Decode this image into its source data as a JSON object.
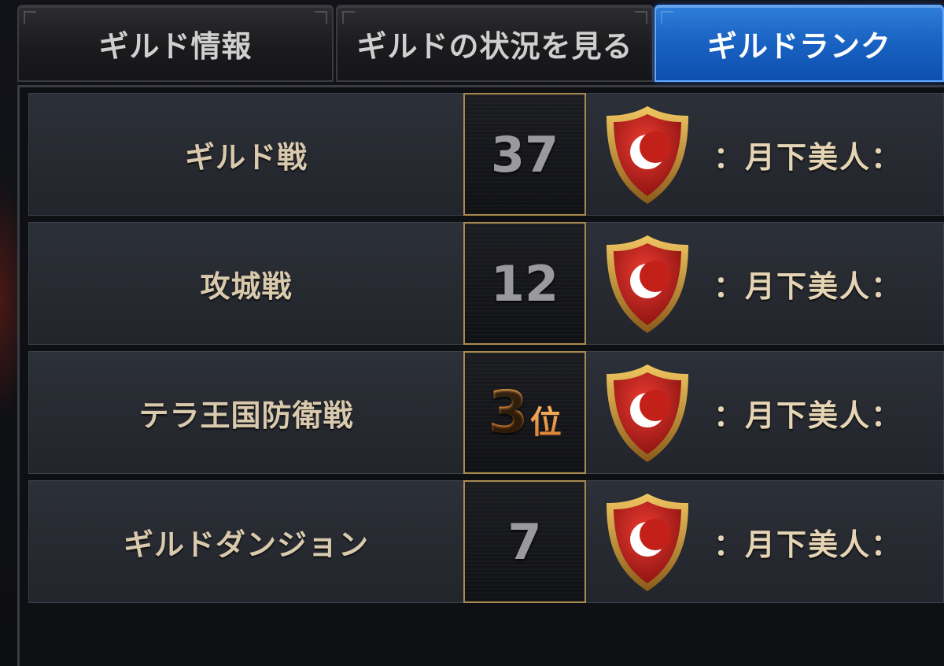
{
  "tabs": [
    {
      "label": "ギルド情報",
      "active": false
    },
    {
      "label": "ギルドの状況を見る",
      "active": false
    },
    {
      "label": "ギルドランク",
      "active": true
    }
  ],
  "rankings": [
    {
      "category": "ギルド戦",
      "rank": "37",
      "suffix": "",
      "guild_name": "：月下美人：",
      "emblem": "red-shield-crescent-icon"
    },
    {
      "category": "攻城戦",
      "rank": "12",
      "suffix": "",
      "guild_name": "：月下美人：",
      "emblem": "red-shield-crescent-icon"
    },
    {
      "category": "テラ王国防衛戦",
      "rank": "3",
      "suffix": "位",
      "guild_name": "：月下美人：",
      "emblem": "red-shield-crescent-icon"
    },
    {
      "category": "ギルドダンジョン",
      "rank": "7",
      "suffix": "",
      "guild_name": "：月下美人：",
      "emblem": "red-shield-crescent-icon"
    }
  ],
  "colors": {
    "active_tab": "#1a64c4",
    "label_text": "#d9c9ad",
    "rank_gold": "#e48a2d",
    "rank_grey": "#9a9a9c",
    "emblem_red": "#c8201e",
    "emblem_gold": "#c9962e"
  }
}
